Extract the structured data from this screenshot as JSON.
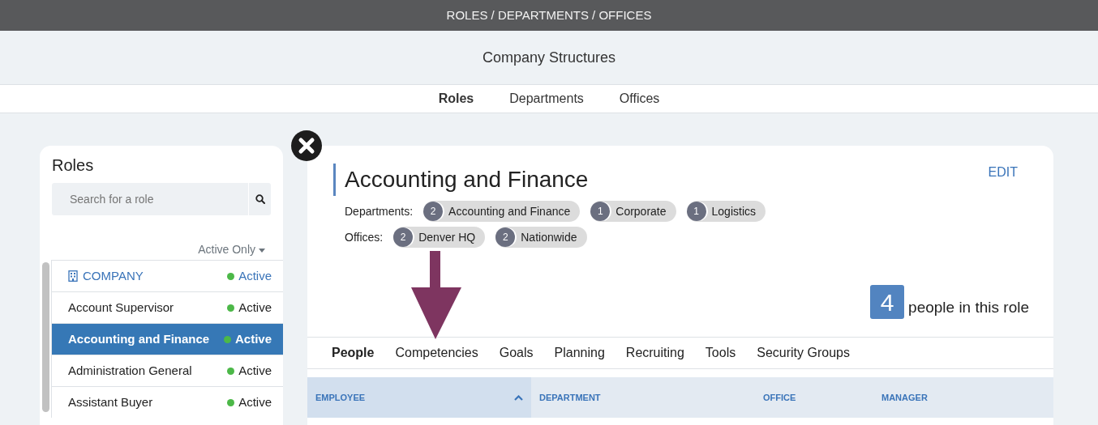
{
  "top_bar": {
    "title": "ROLES / DEPARTMENTS / OFFICES"
  },
  "header": {
    "title": "Company Structures"
  },
  "tabs": [
    {
      "label": "Roles",
      "selected": true
    },
    {
      "label": "Departments",
      "selected": false
    },
    {
      "label": "Offices",
      "selected": false
    }
  ],
  "sidebar": {
    "title": "Roles",
    "search": {
      "placeholder": "Search for a role"
    },
    "filter": "Active Only",
    "items": [
      {
        "label": "COMPANY",
        "kind": "company",
        "status": "Active",
        "selected": false
      },
      {
        "label": "Account Supervisor",
        "kind": "role",
        "status": "Active",
        "selected": false
      },
      {
        "label": "Accounting and Finance",
        "kind": "role",
        "status": "Active",
        "selected": true
      },
      {
        "label": "Administration General",
        "kind": "role",
        "status": "Active",
        "selected": false
      },
      {
        "label": "Assistant Buyer",
        "kind": "role",
        "status": "Active",
        "selected": false
      }
    ]
  },
  "detail": {
    "title": "Accounting and Finance",
    "edit": "EDIT",
    "departments_label": "Departments:",
    "departments": [
      {
        "count": "2",
        "name": "Accounting and Finance"
      },
      {
        "count": "1",
        "name": "Corporate"
      },
      {
        "count": "1",
        "name": "Logistics"
      }
    ],
    "offices_label": "Offices:",
    "offices": [
      {
        "count": "2",
        "name": "Denver HQ"
      },
      {
        "count": "2",
        "name": "Nationwide"
      }
    ],
    "people_count": "4",
    "people_text": "people in this role",
    "tabs": [
      {
        "label": "People",
        "selected": true
      },
      {
        "label": "Competencies",
        "selected": false
      },
      {
        "label": "Goals",
        "selected": false
      },
      {
        "label": "Planning",
        "selected": false
      },
      {
        "label": "Recruiting",
        "selected": false
      },
      {
        "label": "Tools",
        "selected": false
      },
      {
        "label": "Security Groups",
        "selected": false
      }
    ],
    "table": {
      "columns": [
        {
          "label": "EMPLOYEE",
          "sorted": true
        },
        {
          "label": "DEPARTMENT",
          "sorted": false
        },
        {
          "label": "OFFICE",
          "sorted": false
        },
        {
          "label": "MANAGER",
          "sorted": false
        }
      ]
    }
  }
}
